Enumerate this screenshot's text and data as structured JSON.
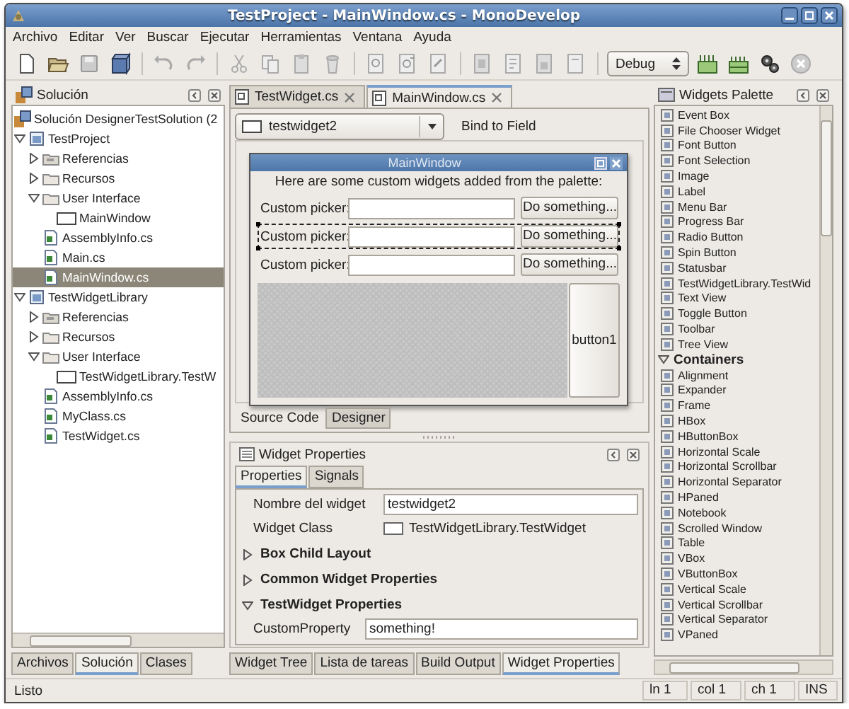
{
  "window": {
    "title": "TestProject - MainWindow.cs - MonoDevelop"
  },
  "menu": [
    "Archivo",
    "Editar",
    "Ver",
    "Buscar",
    "Ejecutar",
    "Herramientas",
    "Ventana",
    "Ayuda"
  ],
  "toolbar": {
    "configuration": "Debug"
  },
  "solution_panel": {
    "title": "Solución",
    "tree": [
      {
        "kind": "solution",
        "label": "Solución DesignerTestSolution (2",
        "selected": false
      },
      {
        "kind": "project",
        "label": "TestProject",
        "expanded": true,
        "selected": false,
        "children": [
          {
            "kind": "references",
            "label": "Referencias",
            "expanded": false,
            "selected": false
          },
          {
            "kind": "folder",
            "label": "Recursos",
            "expanded": false,
            "selected": false
          },
          {
            "kind": "folder",
            "label": "User Interface",
            "expanded": true,
            "selected": false,
            "children": [
              {
                "kind": "window",
                "label": "MainWindow",
                "selected": false
              }
            ]
          },
          {
            "kind": "file",
            "label": "AssemblyInfo.cs",
            "selected": false
          },
          {
            "kind": "file",
            "label": "Main.cs",
            "selected": false
          },
          {
            "kind": "file",
            "label": "MainWindow.cs",
            "selected": true
          }
        ]
      },
      {
        "kind": "project",
        "label": "TestWidgetLibrary",
        "expanded": true,
        "selected": false,
        "children": [
          {
            "kind": "references",
            "label": "Referencias",
            "expanded": false,
            "selected": false
          },
          {
            "kind": "folder",
            "label": "Recursos",
            "expanded": false,
            "selected": false
          },
          {
            "kind": "folder",
            "label": "User Interface",
            "expanded": true,
            "selected": false,
            "children": [
              {
                "kind": "window",
                "label": "TestWidgetLibrary.TestW",
                "selected": false
              }
            ]
          },
          {
            "kind": "file",
            "label": "AssemblyInfo.cs",
            "selected": false
          },
          {
            "kind": "file",
            "label": "MyClass.cs",
            "selected": false
          },
          {
            "kind": "file",
            "label": "TestWidget.cs",
            "selected": false
          }
        ]
      }
    ],
    "tabs": [
      {
        "label": "Archivos",
        "selected": false
      },
      {
        "label": "Solución",
        "selected": true
      },
      {
        "label": "Clases",
        "selected": false
      }
    ]
  },
  "editor": {
    "tabs": [
      {
        "label": "TestWidget.cs",
        "selected": false
      },
      {
        "label": "MainWindow.cs",
        "selected": true
      }
    ],
    "widget_selector": "testwidget2",
    "bind_button": "Bind to Field",
    "designer": {
      "window_title": "MainWindow",
      "intro": "Here are some custom widgets added from the palette:",
      "rows": [
        {
          "label": "Custom picker:",
          "button": "Do something...",
          "selected": false
        },
        {
          "label": "Custom picker:",
          "button": "Do something...",
          "selected": true
        },
        {
          "label": "Custom picker:",
          "button": "Do something...",
          "selected": false
        }
      ],
      "side_button": "button1"
    },
    "view_tabs": [
      {
        "label": "Source Code",
        "selected": false
      },
      {
        "label": "Designer",
        "selected": true
      }
    ]
  },
  "properties": {
    "title": "Widget Properties",
    "tabs": [
      {
        "label": "Properties",
        "selected": true
      },
      {
        "label": "Signals",
        "selected": false
      }
    ],
    "name_label": "Nombre del widget",
    "name_value": "testwidget2",
    "class_label": "Widget Class",
    "class_value": "TestWidgetLibrary.TestWidget",
    "sections": [
      {
        "label": "Box Child Layout",
        "expanded": false
      },
      {
        "label": "Common Widget Properties",
        "expanded": false
      },
      {
        "label": "TestWidget Properties",
        "expanded": true,
        "rows": [
          {
            "label": "CustomProperty",
            "value": "something!"
          }
        ]
      }
    ]
  },
  "bottom_tabs": [
    {
      "label": "Widget Tree",
      "selected": false
    },
    {
      "label": "Lista de tareas",
      "selected": false
    },
    {
      "label": "Build Output",
      "selected": false
    },
    {
      "label": "Widget Properties",
      "selected": true
    }
  ],
  "palette": {
    "title": "Widgets Palette",
    "items": [
      {
        "kind": "item",
        "label": "Event Box"
      },
      {
        "kind": "item",
        "label": "File Chooser Widget"
      },
      {
        "kind": "item",
        "label": "Font Button"
      },
      {
        "kind": "item",
        "label": "Font Selection"
      },
      {
        "kind": "item",
        "label": "Image"
      },
      {
        "kind": "item",
        "label": "Label"
      },
      {
        "kind": "item",
        "label": "Menu Bar"
      },
      {
        "kind": "item",
        "label": "Progress Bar"
      },
      {
        "kind": "item",
        "label": "Radio Button"
      },
      {
        "kind": "item",
        "label": "Spin Button"
      },
      {
        "kind": "item",
        "label": "Statusbar"
      },
      {
        "kind": "item",
        "label": "TestWidgetLibrary.TestWid"
      },
      {
        "kind": "item",
        "label": "Text View"
      },
      {
        "kind": "item",
        "label": "Toggle Button"
      },
      {
        "kind": "item",
        "label": "Toolbar"
      },
      {
        "kind": "item",
        "label": "Tree View"
      },
      {
        "kind": "group",
        "label": "Containers",
        "expanded": true
      },
      {
        "kind": "item",
        "label": "Alignment"
      },
      {
        "kind": "item",
        "label": "Expander"
      },
      {
        "kind": "item",
        "label": "Frame"
      },
      {
        "kind": "item",
        "label": "HBox"
      },
      {
        "kind": "item",
        "label": "HButtonBox"
      },
      {
        "kind": "item",
        "label": "Horizontal Scale"
      },
      {
        "kind": "item",
        "label": "Horizontal Scrollbar"
      },
      {
        "kind": "item",
        "label": "Horizontal Separator"
      },
      {
        "kind": "item",
        "label": "HPaned"
      },
      {
        "kind": "item",
        "label": "Notebook"
      },
      {
        "kind": "item",
        "label": "Scrolled Window"
      },
      {
        "kind": "item",
        "label": "Table"
      },
      {
        "kind": "item",
        "label": "VBox"
      },
      {
        "kind": "item",
        "label": "VButtonBox"
      },
      {
        "kind": "item",
        "label": "Vertical Scale"
      },
      {
        "kind": "item",
        "label": "Vertical Scrollbar"
      },
      {
        "kind": "item",
        "label": "Vertical Separator"
      },
      {
        "kind": "item",
        "label": "VPaned"
      }
    ]
  },
  "status_bar": {
    "message": "Listo",
    "line": "ln 1",
    "column": "col 1",
    "char": "ch 1",
    "mode": "INS"
  }
}
